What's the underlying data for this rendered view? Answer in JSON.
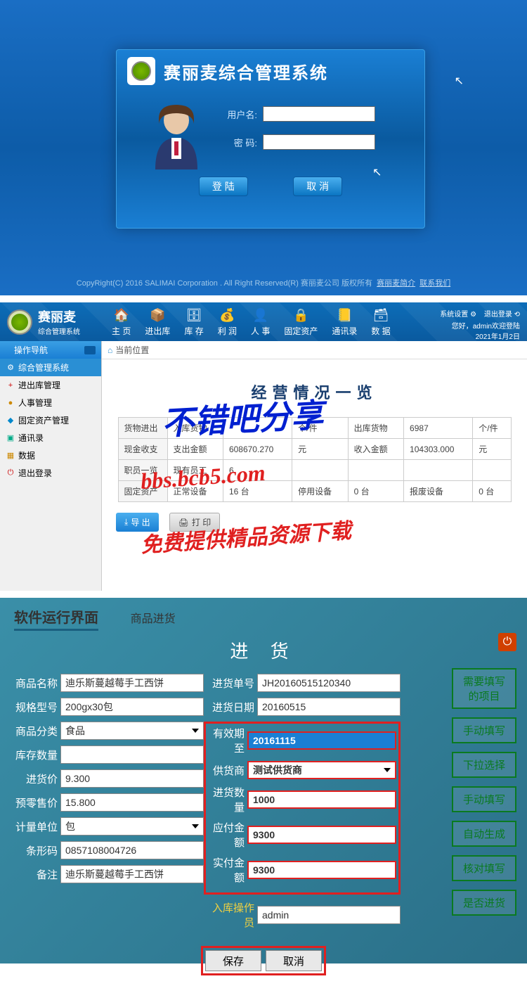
{
  "panel1": {
    "system_title": "赛丽麦综合管理系统",
    "username_label": "用户名:",
    "password_label": "密 码:",
    "login_btn": "登 陆",
    "cancel_btn": "取 消",
    "copyright": "CopyRight(C) 2016 SALIMAI Corporation . All Right Reserved(R) 赛丽麦公司 版权所有",
    "link1": "赛丽麦简介",
    "link2": "联系我们"
  },
  "panel2": {
    "brand_main": "赛丽麦",
    "brand_sub": "综合管理系统",
    "nav": [
      "主 页",
      "进出库",
      "库 存",
      "利 润",
      "人 事",
      "固定资产",
      "通讯录",
      "数 据"
    ],
    "top_right_1": "系统设置 ⚙",
    "top_right_2": "退出登录 ⟲",
    "welcome": "您好，admin欢迎登陆",
    "date": "2021年1月2日",
    "sidebar_title": "操作导航",
    "sidebar_items": [
      "综合管理系统",
      "进出库管理",
      "人事管理",
      "固定资产管理",
      "通讯录",
      "数据",
      "退出登录"
    ],
    "breadcrumb": "当前位置",
    "content_title": "经营情况一览",
    "table": {
      "r1": {
        "lbl": "货物进出",
        "c1": "入库货物",
        "c2": "",
        "c3": "个/件",
        "c4": "出库货物",
        "c5": "6987",
        "c6": "个/件"
      },
      "r2": {
        "lbl": "现金收支",
        "c1": "支出金额",
        "c2": "608670.270",
        "c3": "元",
        "c4": "收入金额",
        "c5": "104303.000",
        "c6": "元"
      },
      "r3": {
        "lbl": "职员一览",
        "c1": "现有员工",
        "c2": "6",
        "c3": "",
        "c4": "",
        "c5": "",
        "c6": ""
      },
      "r4": {
        "lbl": "固定资产",
        "c1": "正常设备",
        "c2": "16 台",
        "c3": "停用设备",
        "c4": "0 台",
        "c5": "报废设备",
        "c6": "0 台"
      }
    },
    "export_btn": "导 出",
    "print_btn": "打 印",
    "watermark1": "不错吧分享",
    "watermark2": "bbs.bcb5.com",
    "watermark3": "免费提供精品资源下载"
  },
  "panel3": {
    "tab_main": "软件运行界面",
    "tab_sub": "商品进货",
    "form_title": "进 货",
    "left": {
      "product_name": {
        "label": "商品名称",
        "value": "迪乐斯蔓越莓手工西饼"
      },
      "spec": {
        "label": "规格型号",
        "value": "200gx30包"
      },
      "category": {
        "label": "商品分类",
        "value": "食品"
      },
      "stock_qty": {
        "label": "库存数量",
        "value": ""
      },
      "purchase_price": {
        "label": "进货价",
        "value": "9.300"
      },
      "retail_price": {
        "label": "预零售价",
        "value": "15.800"
      },
      "unit": {
        "label": "计量单位",
        "value": "包"
      },
      "barcode": {
        "label": "条形码",
        "value": "0857108004726"
      },
      "remark": {
        "label": "备注",
        "value": "迪乐斯蔓越莓手工西饼"
      }
    },
    "right": {
      "order_no": {
        "label": "进货单号",
        "value": "JH20160515120340"
      },
      "order_date": {
        "label": "进货日期",
        "value": "20160515"
      },
      "expire": {
        "label": "有效期至",
        "value": "20161115"
      },
      "supplier": {
        "label": "供货商",
        "value": "测试供货商"
      },
      "qty": {
        "label": "进货数量",
        "value": "1000"
      },
      "payable": {
        "label": "应付金额",
        "value": "9300"
      },
      "paid": {
        "label": "实付金额",
        "value": "9300"
      },
      "operator": {
        "label": "入库操作员",
        "value": "admin"
      }
    },
    "legend": [
      "需要填写\n的项目",
      "手动填写",
      "下拉选择",
      "手动填写",
      "自动生成",
      "核对填写",
      "是否进货"
    ],
    "save_btn": "保存",
    "cancel_btn": "取消"
  }
}
